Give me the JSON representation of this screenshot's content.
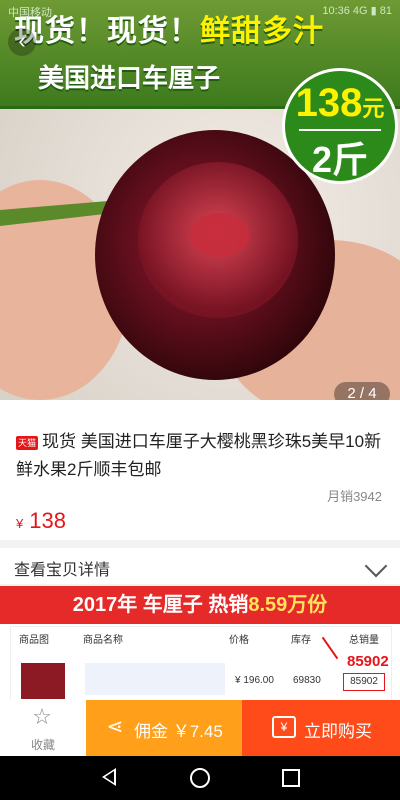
{
  "status_bar": {
    "left": "中国移动",
    "right": "10:36  4G  ▮ 81"
  },
  "hero": {
    "banner_line1_white": "现货！现货！",
    "banner_line1_yellow": "鲜甜多汁",
    "banner_line2": "美国进口车厘子",
    "price_amount": "138",
    "price_unit": "元",
    "price_qty": "2斤",
    "counter": "2 / 4"
  },
  "product": {
    "tmall_badge": "天猫",
    "title": "现货 美国进口车厘子大樱桃黑珍珠5美早10新鲜水果2斤顺丰包邮",
    "monthly_sales": "月销3942",
    "currency": "¥",
    "price": "138"
  },
  "details": {
    "label": "查看宝贝详情"
  },
  "promo": {
    "headline_a": "2017年 车厘子 热销",
    "headline_b": "8.59万份",
    "columns": [
      "商品图",
      "商品名称",
      "价格",
      "库存",
      "总销量"
    ],
    "row_price": "¥ 196.00",
    "row_stock": "69830",
    "row_sales": "85902",
    "highlight_sales": "85902"
  },
  "bottom": {
    "favorite_label": "收藏",
    "commission_label": "佣金 ￥7.45",
    "buy_label": "立即购买"
  },
  "colors": {
    "red": "#e4161a",
    "orange": "#ff9f1a",
    "buy": "#ff4a1a",
    "banner_green": "#3d7a1d"
  }
}
